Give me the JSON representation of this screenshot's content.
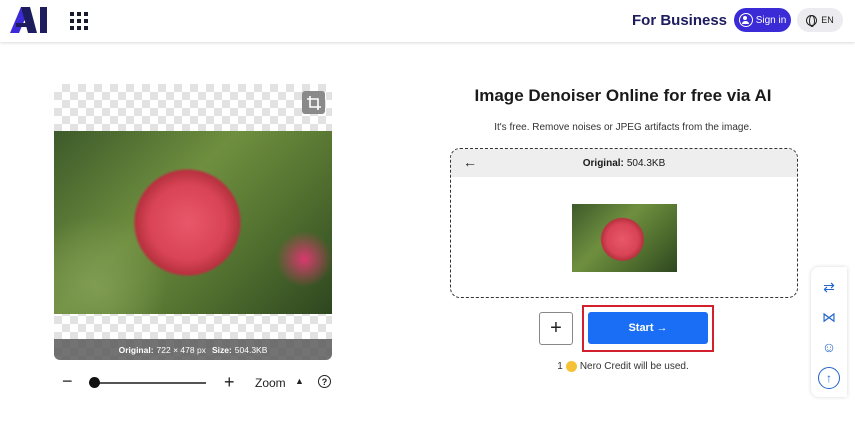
{
  "header": {
    "for_business": "For Business",
    "signin_label": "Sign in",
    "lang_label": "EN",
    "accent": "#3a2bd6"
  },
  "preview": {
    "original_label": "Original:",
    "original_dims": "722 × 478 px",
    "size_label": "Size:",
    "size_value": "504.3KB"
  },
  "zoom": {
    "minus": "−",
    "plus": "+",
    "label": "Zoom",
    "caret": "▲",
    "help": "?"
  },
  "main": {
    "title": "Image Denoiser Online for free via AI",
    "subtitle": "It's free. Remove noises or JPEG artifacts from the image.",
    "upload_original_label": "Original:",
    "upload_original_value": "504.3KB",
    "back_arrow": "←",
    "add_label": "+",
    "start_label": "Start →",
    "start_color": "#1a6ef5",
    "credit_count": "1",
    "credit_text": "Nero Credit will be used."
  },
  "side": {
    "tool1": "⇄",
    "tool2": "⋈",
    "tool3": "☺",
    "tool4": "↑"
  }
}
